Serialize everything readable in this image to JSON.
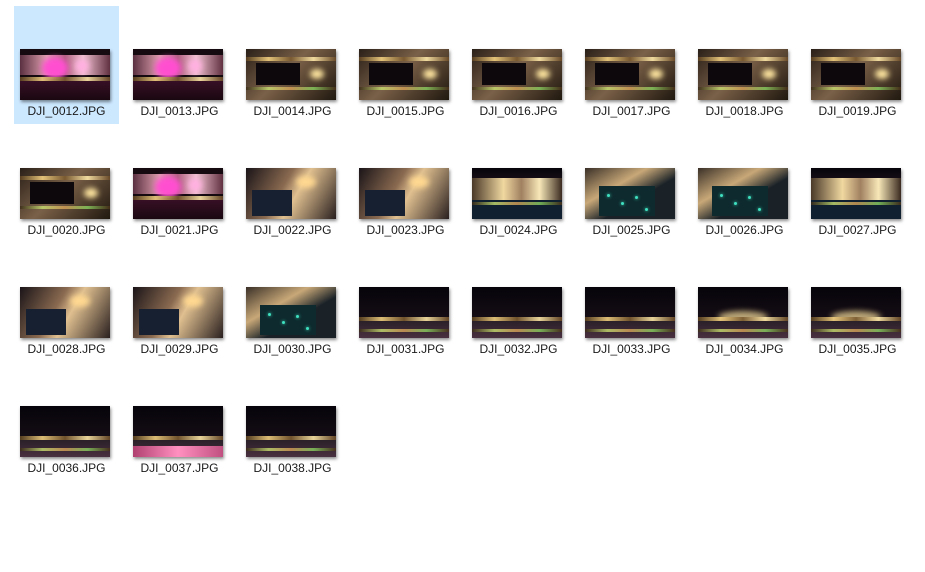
{
  "files": [
    {
      "name": "DJI_0012.JPG",
      "selected": true,
      "scene": "magenta-plaza"
    },
    {
      "name": "DJI_0013.JPG",
      "selected": false,
      "scene": "magenta-plaza"
    },
    {
      "name": "DJI_0014.JPG",
      "selected": false,
      "scene": "rooftops"
    },
    {
      "name": "DJI_0015.JPG",
      "selected": false,
      "scene": "rooftops"
    },
    {
      "name": "DJI_0016.JPG",
      "selected": false,
      "scene": "rooftops"
    },
    {
      "name": "DJI_0017.JPG",
      "selected": false,
      "scene": "rooftops"
    },
    {
      "name": "DJI_0018.JPG",
      "selected": false,
      "scene": "rooftops"
    },
    {
      "name": "DJI_0019.JPG",
      "selected": false,
      "scene": "rooftops"
    },
    {
      "name": "DJI_0020.JPG",
      "selected": false,
      "scene": "rooftops"
    },
    {
      "name": "DJI_0021.JPG",
      "selected": false,
      "scene": "magenta-plaza"
    },
    {
      "name": "DJI_0022.JPG",
      "selected": false,
      "scene": "courtyard"
    },
    {
      "name": "DJI_0023.JPG",
      "selected": false,
      "scene": "courtyard"
    },
    {
      "name": "DJI_0024.JPG",
      "selected": false,
      "scene": "facade"
    },
    {
      "name": "DJI_0025.JPG",
      "selected": false,
      "scene": "teal-pool"
    },
    {
      "name": "DJI_0026.JPG",
      "selected": false,
      "scene": "teal-pool"
    },
    {
      "name": "DJI_0027.JPG",
      "selected": false,
      "scene": "facade"
    },
    {
      "name": "DJI_0028.JPG",
      "selected": false,
      "scene": "courtyard"
    },
    {
      "name": "DJI_0029.JPG",
      "selected": false,
      "scene": "courtyard"
    },
    {
      "name": "DJI_0030.JPG",
      "selected": false,
      "scene": "teal-pool"
    },
    {
      "name": "DJI_0031.JPG",
      "selected": false,
      "scene": "skyline"
    },
    {
      "name": "DJI_0032.JPG",
      "selected": false,
      "scene": "skyline"
    },
    {
      "name": "DJI_0033.JPG",
      "selected": false,
      "scene": "skyline"
    },
    {
      "name": "DJI_0034.JPG",
      "selected": false,
      "scene": "skyline-bright"
    },
    {
      "name": "DJI_0035.JPG",
      "selected": false,
      "scene": "skyline-bright"
    },
    {
      "name": "DJI_0036.JPG",
      "selected": false,
      "scene": "skyline"
    },
    {
      "name": "DJI_0037.JPG",
      "selected": false,
      "scene": "skyline-pink"
    },
    {
      "name": "DJI_0038.JPG",
      "selected": false,
      "scene": "skyline"
    }
  ],
  "colors": {
    "selection": "#cce8ff",
    "label_text": "#1a1a1a",
    "background": "#ffffff"
  }
}
